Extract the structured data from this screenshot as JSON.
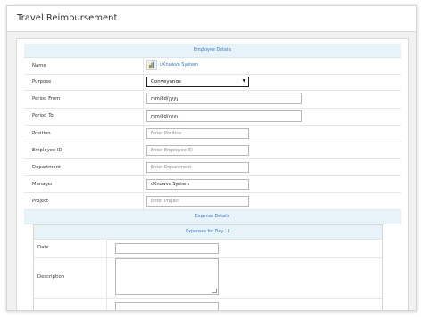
{
  "page": {
    "title": "Travel Reimbursement"
  },
  "employee_details": {
    "heading": "Employee Details",
    "fields": {
      "name": {
        "label": "Name",
        "value": "uKnowva System"
      },
      "purpose": {
        "label": "Purpose",
        "value": "Conveyance"
      },
      "period_from": {
        "label": "Period From",
        "value": "mm/dd/yyyy"
      },
      "period_to": {
        "label": "Period To",
        "value": "mm/dd/yyyy"
      },
      "position": {
        "label": "Position",
        "placeholder": "Enter Position"
      },
      "employee_id": {
        "label": "Employee ID",
        "placeholder": "Enter Employee ID"
      },
      "department": {
        "label": "Department",
        "placeholder": "Enter Department"
      },
      "manager": {
        "label": "Manager",
        "value": "uKnowva System"
      },
      "project": {
        "label": "Project",
        "placeholder": "Enter Project"
      }
    }
  },
  "expense_details": {
    "heading": "Expense Details",
    "day_heading": "Expenses for Day : 1",
    "fields": {
      "date": {
        "label": "Date",
        "value": ""
      },
      "description": {
        "label": "Description",
        "value": ""
      }
    }
  },
  "icons": {
    "name_avatar": "user-photo-icon",
    "purpose_select": "caret-down-icon"
  },
  "colors": {
    "section_header_bg": "#e8f2f9",
    "accent_text": "#3478c1"
  }
}
